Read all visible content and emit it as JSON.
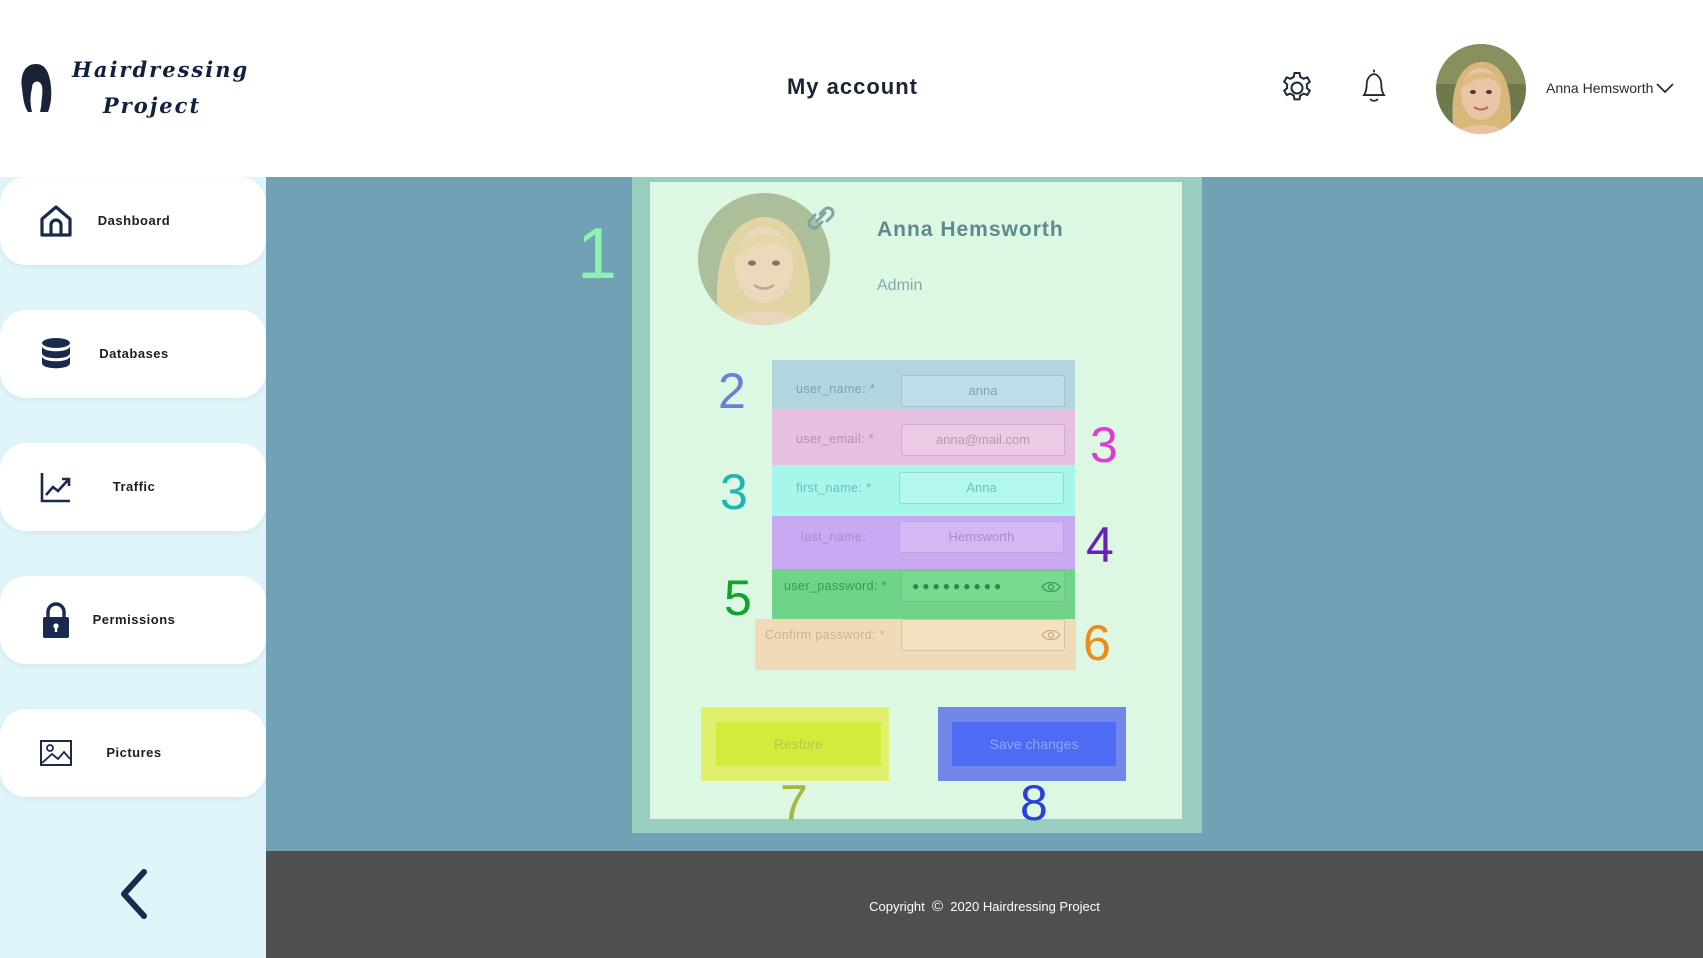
{
  "header": {
    "logo_line1": "Hairdressing",
    "logo_line2": "Project",
    "title": "My account",
    "user_name": "Anna Hemsworth",
    "icons": [
      "logo-icon",
      "gear-icon",
      "bell-icon",
      "chevron-down-icon"
    ]
  },
  "sidebar": {
    "items": [
      {
        "label": "Dashboard",
        "icon": "home-icon"
      },
      {
        "label": "Databases",
        "icon": "database-icon"
      },
      {
        "label": "Traffic",
        "icon": "chart-icon"
      },
      {
        "label": "Permissions",
        "icon": "lock-icon"
      },
      {
        "label": "Pictures",
        "icon": "image-icon"
      }
    ],
    "collapse_icon": "chevron-left-icon"
  },
  "profile": {
    "name": "Anna Hemsworth",
    "role": "Admin"
  },
  "form": {
    "fields": [
      {
        "label": "user_name: *",
        "value": "anna",
        "highlight": "#b3d5e0",
        "annotation": "2",
        "annotation_color": "#6a7fd8"
      },
      {
        "label": "user_email: *",
        "value": "anna@mail.com",
        "highlight": "#e7bfe0",
        "annotation": "3",
        "annotation_color": "#e03ad6"
      },
      {
        "label": "first_name: *",
        "value": "Anna",
        "highlight": "#a6f6ec",
        "annotation": "3",
        "annotation_color": "#1fb3b3"
      },
      {
        "label": "last_name:",
        "value": "Hemsworth",
        "highlight": "#c9aaf2",
        "annotation": "4",
        "annotation_color": "#6a1fb8"
      },
      {
        "label": "user_password: *",
        "value": "●●●●●●●●●",
        "highlight": "#6fd487",
        "annotation": "5",
        "annotation_color": "#12a32a"
      },
      {
        "label": "Confirm password: *",
        "value": "",
        "highlight": "#f1dbb6",
        "annotation": "6",
        "annotation_color": "#f08a1a"
      }
    ]
  },
  "buttons": {
    "restore_label": "Restore",
    "save_label": "Save changes",
    "restore_annotation": "7",
    "save_annotation": "8"
  },
  "annotations": {
    "avatar": "1"
  },
  "colors": {
    "main_bg": "#70a1b4",
    "card_bg": "#dcf8e3",
    "sidebar_bg": "#dff5fa",
    "footer_bg": "#4f4f4f",
    "restore_btn": "#d4eb3c",
    "save_btn": "#4e6cf3"
  },
  "footer": {
    "copyright_prefix": "Copyright",
    "copyright_symbol": "©",
    "copyright_text": "2020 Hairdressing Project"
  }
}
